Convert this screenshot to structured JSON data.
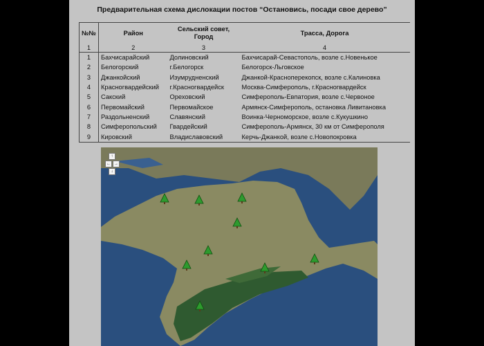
{
  "title": "Предварительная схема дислокации постов “Остановись, посади свое дерево”",
  "table": {
    "headers": [
      "№№",
      "Район",
      "Сельский совет, Город",
      "Трасса, Дорога"
    ],
    "header_numbers": [
      "1",
      "2",
      "3",
      "4"
    ],
    "rows": [
      [
        "1",
        "Бахчисарайский",
        "Долиновский",
        "Бахчисарай-Севастополь, возле с.Новенькое"
      ],
      [
        "2",
        "Белогорский",
        "г.Белогорск",
        "Белогорск-Льговское"
      ],
      [
        "3",
        "Джанкойский",
        "Изумрудненский",
        "Джанкой-Красноперекопск, возле с.Калиновка"
      ],
      [
        "4",
        "Красногвардейский",
        "г.Красногвардейск",
        "Москва-Симферополь, г.Красногвардейск"
      ],
      [
        "5",
        "Сакский",
        "Ореховский",
        "Симферополь-Евпатория, возле с.Червоное"
      ],
      [
        "6",
        "Первомайский",
        "Первомайское",
        "Армянск-Симферополь, остановка Ливитановка"
      ],
      [
        "7",
        "Раздольненский",
        "Славянский",
        "Воинка-Черноморское, возле с.Кукушкино"
      ],
      [
        "8",
        "Симферопольский",
        "Гвардейский",
        "Симферополь-Армянск, 30 км от Симферополя"
      ],
      [
        "9",
        "Кировский",
        "Владиславовский",
        "Керчь-Джанкой, возле с.Новопокровка"
      ]
    ]
  },
  "map": {
    "nav_icons": [
      "arrow-up-icon",
      "arrow-left-icon",
      "arrow-right-icon",
      "arrow-down-icon"
    ],
    "marker_color": "#2e9a2e",
    "sea_color": "#2a4f7e",
    "land_color": "#8a8a62"
  }
}
